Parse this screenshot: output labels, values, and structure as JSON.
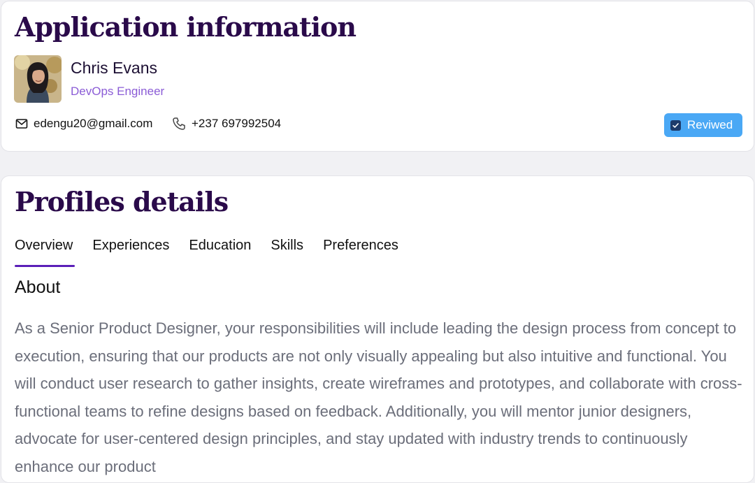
{
  "application": {
    "heading": "Application information",
    "applicant": {
      "name": "Chris Evans",
      "role": "DevOps Engineer"
    },
    "contact": {
      "email": "edengu20@gmail.com",
      "phone": "+237 697992504"
    },
    "status": {
      "label": "Reviwed",
      "checked": true
    }
  },
  "profile": {
    "heading": "Profiles details",
    "tabs": [
      {
        "label": "Overview",
        "active": true
      },
      {
        "label": "Experiences",
        "active": false
      },
      {
        "label": "Education",
        "active": false
      },
      {
        "label": "Skills",
        "active": false
      },
      {
        "label": "Preferences",
        "active": false
      }
    ],
    "about": {
      "title": "About",
      "text": "As a Senior Product Designer, your responsibilities will include leading the design process from concept to execution, ensuring that our products are not only visually appealing but also intuitive and functional. You will conduct user research to gather insights, create wireframes and prototypes, and collaborate with cross-functional teams to refine designs based on feedback. Additionally, you will mentor junior designers, advocate for user-centered design principles, and stay updated with industry trends to continuously enhance our product"
    }
  },
  "colors": {
    "heading": "#2a0a4a",
    "accent": "#5b1fb8",
    "role": "#8b5cd6",
    "badge": "#4aa8f5",
    "body_text": "#6b6e7a"
  },
  "icons": {
    "email": "mail-icon",
    "phone": "phone-icon",
    "status": "checkbox-checked-icon"
  }
}
